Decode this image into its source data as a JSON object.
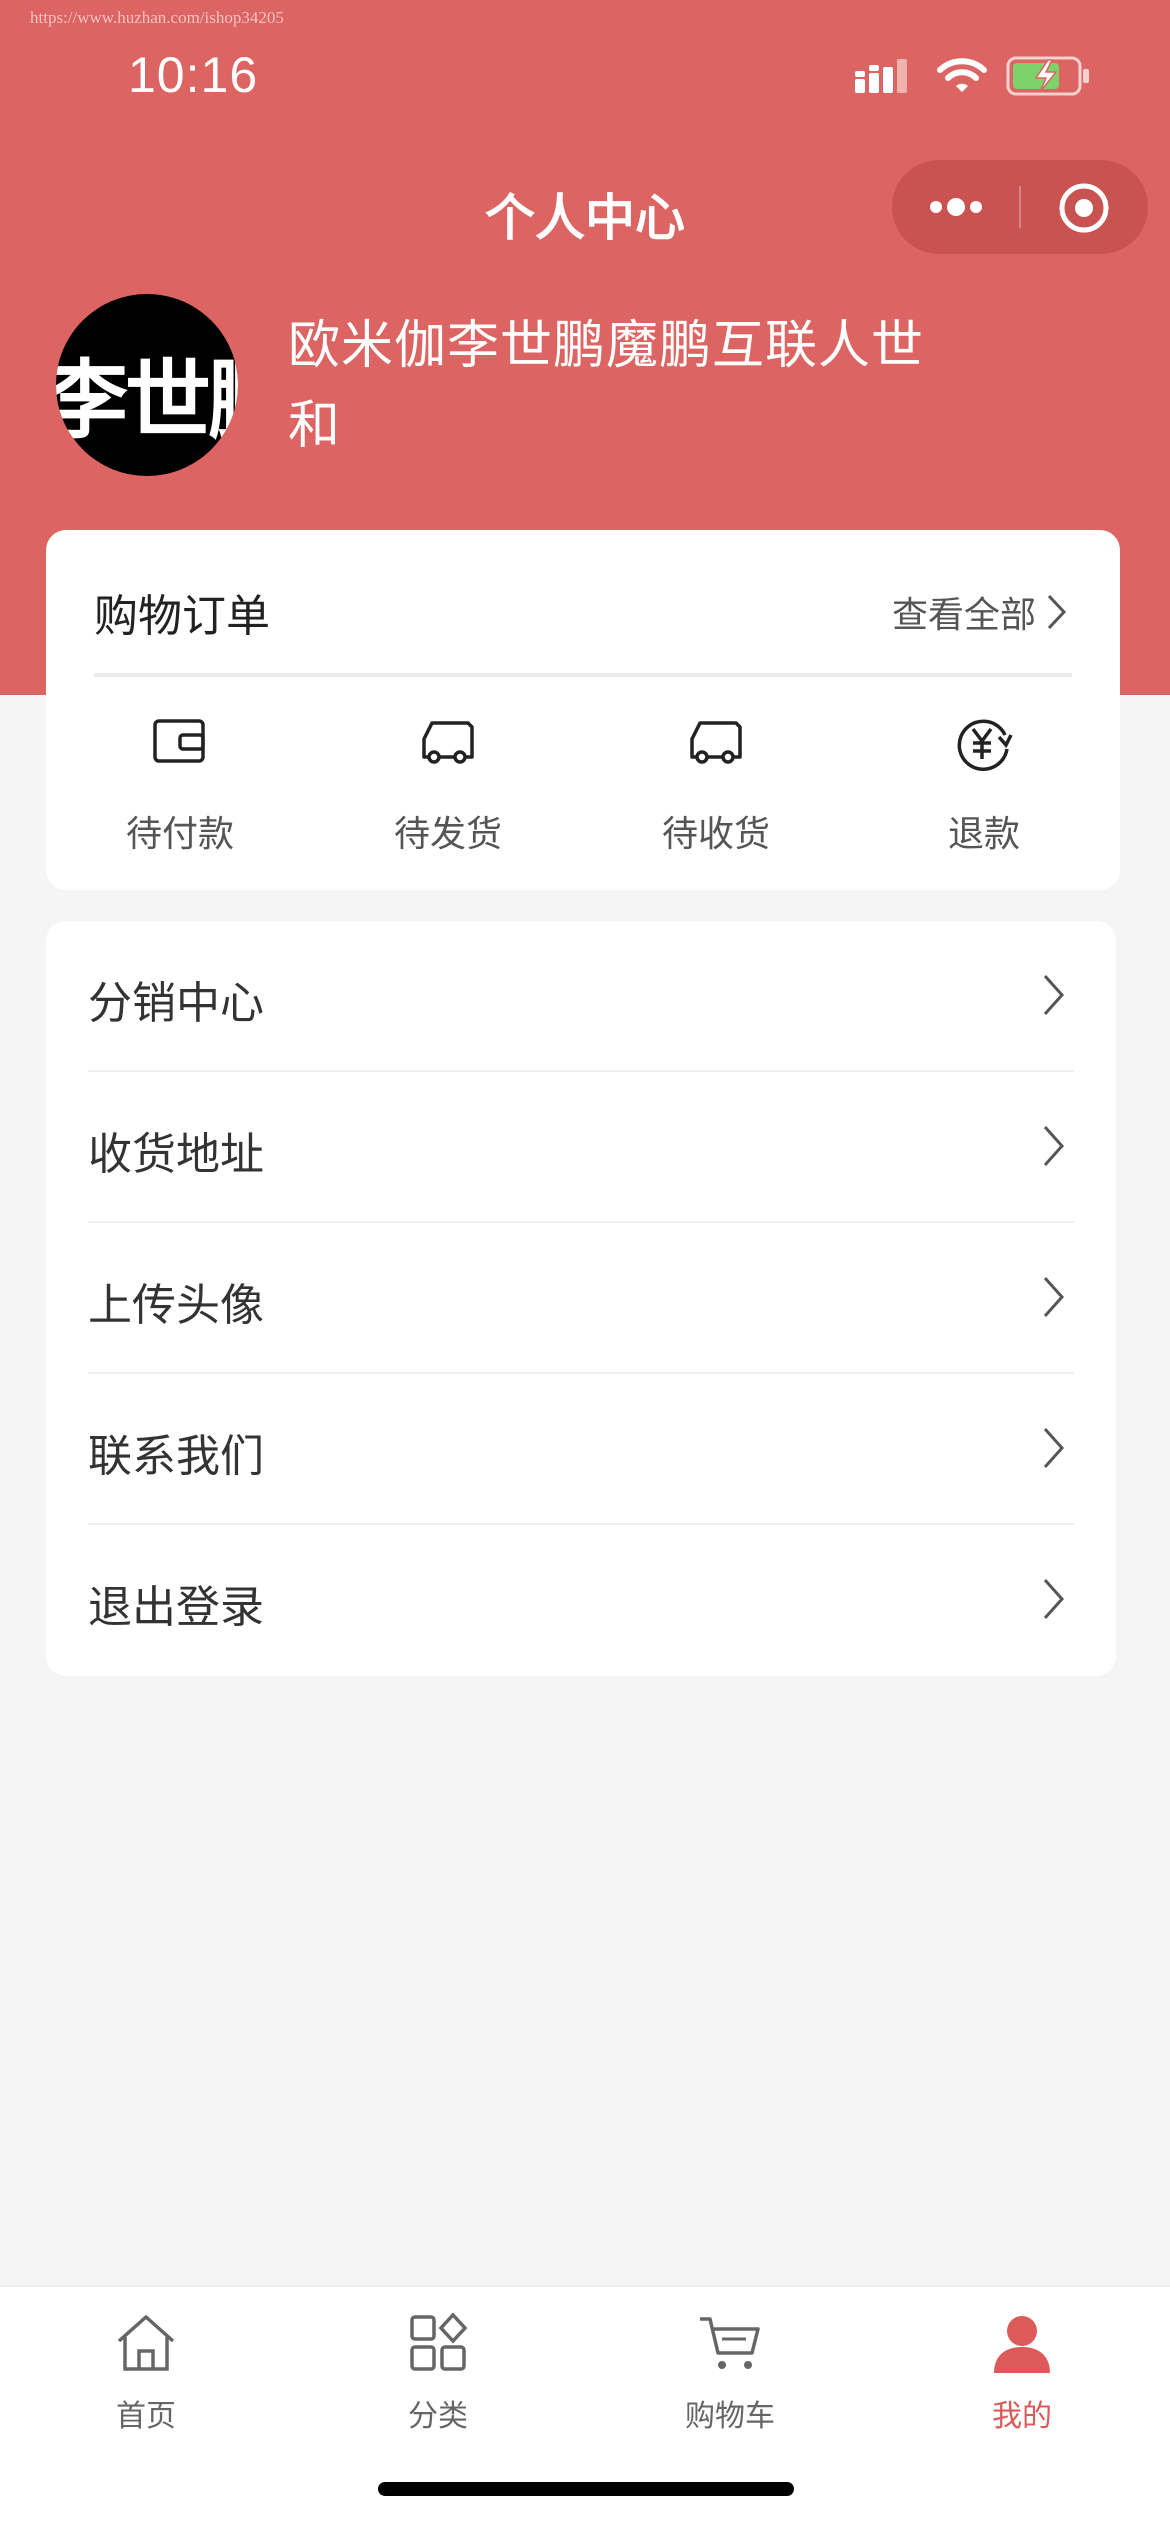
{
  "watermark": "https://www.huzhan.com/ishop34205",
  "status_bar": {
    "time": "10:16"
  },
  "nav": {
    "title": "个人中心"
  },
  "user": {
    "avatar_text": "李世鹏",
    "name": "欧米伽李世鹏魔鹏互联人世和"
  },
  "orders": {
    "title": "购物订单",
    "view_all": "查看全部",
    "items": [
      {
        "label": "待付款",
        "icon": "wallet-icon"
      },
      {
        "label": "待发货",
        "icon": "truck-icon"
      },
      {
        "label": "待收货",
        "icon": "truck-icon"
      },
      {
        "label": "退款",
        "icon": "refund-yen-icon"
      }
    ]
  },
  "menu": {
    "items": [
      {
        "label": "分销中心"
      },
      {
        "label": "收货地址"
      },
      {
        "label": "上传头像"
      },
      {
        "label": "联系我们"
      },
      {
        "label": "退出登录"
      }
    ]
  },
  "tabbar": {
    "items": [
      {
        "label": "首页",
        "icon": "home-icon"
      },
      {
        "label": "分类",
        "icon": "category-icon"
      },
      {
        "label": "购物车",
        "icon": "cart-icon"
      },
      {
        "label": "我的",
        "icon": "user-icon",
        "active": true
      }
    ]
  },
  "colors": {
    "brand": "#dc6462",
    "active_tab": "#dc5a5a",
    "background": "#f5f5f5"
  }
}
